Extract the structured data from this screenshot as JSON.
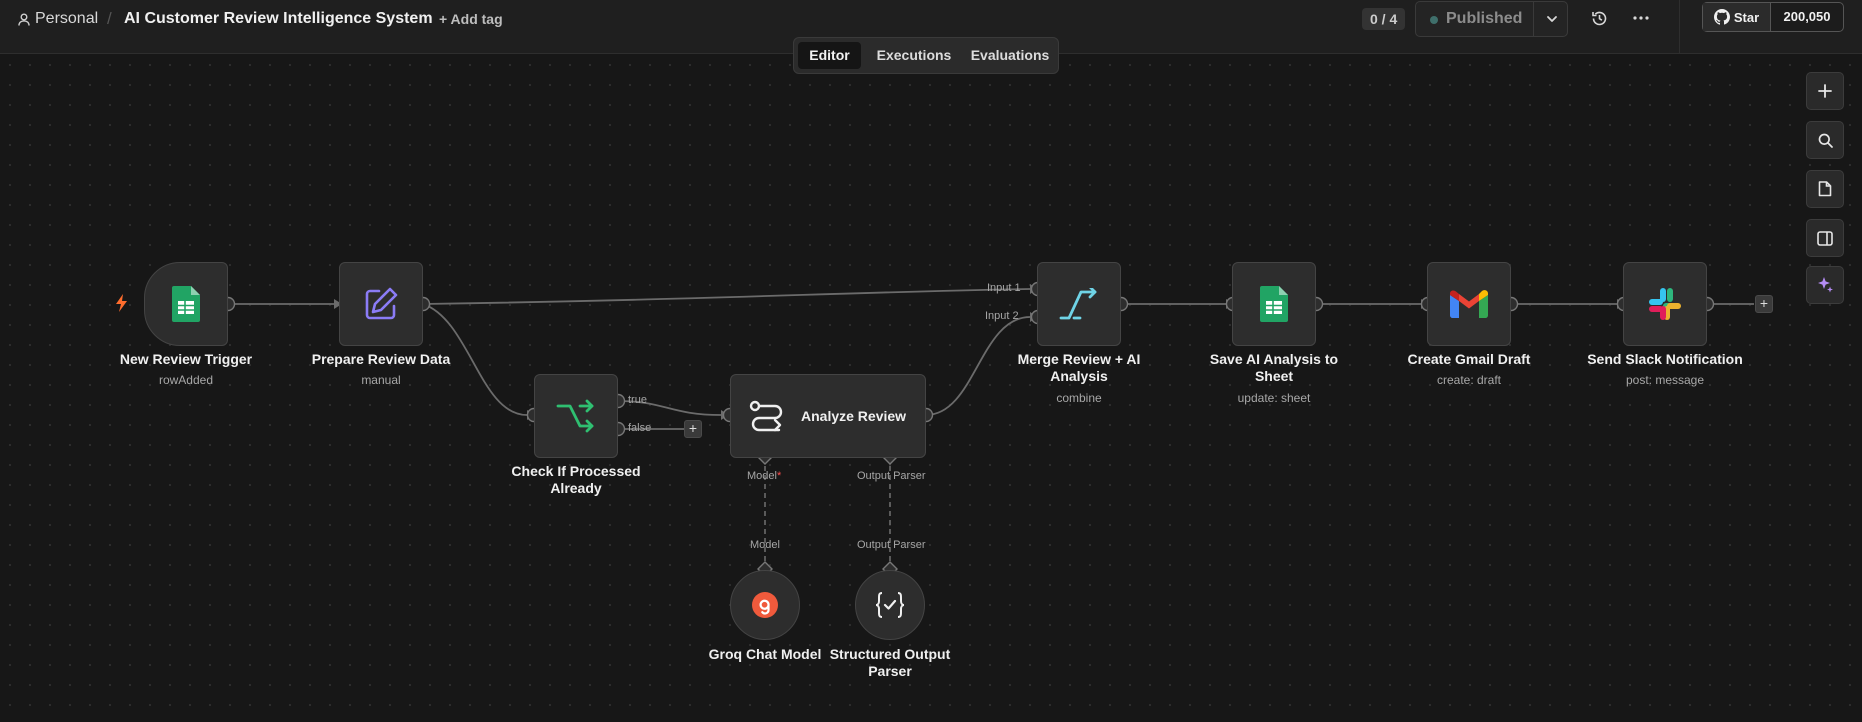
{
  "header": {
    "breadcrumb_personal": "Personal",
    "workflow_title": "AI Customer Review Intelligence System",
    "add_tag": "+ Add tag",
    "counter": "0 / 4",
    "publish_status": "Published",
    "github_star": "Star",
    "github_count": "200,050"
  },
  "tabs": [
    "Editor",
    "Executions",
    "Evaluations"
  ],
  "active_tab": "Editor",
  "nodes": {
    "new_review_trigger": {
      "title": "New Review Trigger",
      "subtitle": "rowAdded"
    },
    "prepare_review_data": {
      "title": "Prepare Review Data",
      "subtitle": "manual"
    },
    "check_if_processed": {
      "title": "Check If Processed Already",
      "output_true": "true",
      "output_false": "false"
    },
    "analyze_review": {
      "title": "Analyze Review",
      "port_model": "Model",
      "port_model_required": "*",
      "port_parser": "Output Parser"
    },
    "merge": {
      "title": "Merge Review + AI Analysis",
      "subtitle": "combine",
      "input1": "Input 1",
      "input2": "Input 2"
    },
    "save_to_sheet": {
      "title": "Save AI Analysis to Sheet",
      "subtitle": "update: sheet"
    },
    "create_gmail_draft": {
      "title": "Create Gmail Draft",
      "subtitle": "create: draft"
    },
    "send_slack": {
      "title": "Send Slack Notification",
      "subtitle": "post: message"
    },
    "groq_chat_model": {
      "title": "Groq Chat Model",
      "port_label": "Model"
    },
    "structured_output_parser": {
      "title": "Structured Output Parser",
      "port_label": "Output Parser"
    }
  },
  "icons": {
    "trigger": "lightning-icon",
    "sheets": "google-sheets-icon",
    "edit": "pencil-square-icon",
    "if": "split-branch-icon",
    "agent": "ai-agent-route-icon",
    "merge": "merge-icon",
    "gmail": "gmail-icon",
    "slack": "slack-icon",
    "groq": "groq-icon",
    "parser": "json-check-icon"
  },
  "colors": {
    "canvas": "#171717",
    "sheets_green": "#21a464",
    "edit_purple": "#8b7cf6",
    "if_green": "#2fbf71",
    "merge_cyan": "#6fd3e6",
    "groq_red": "#f05a3c",
    "trigger_orange": "#ff6d2d"
  }
}
